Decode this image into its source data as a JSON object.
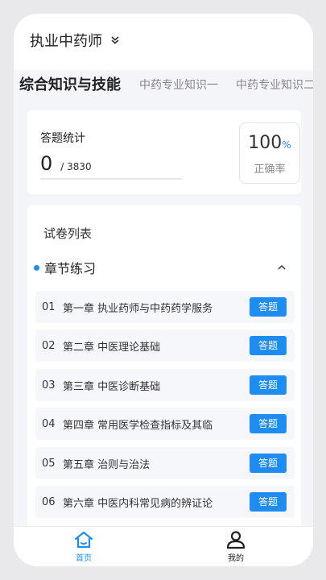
{
  "header": {
    "title": "执业中药师"
  },
  "tabs": [
    {
      "label": "综合知识与技能",
      "active": true
    },
    {
      "label": "中药专业知识一",
      "active": false
    },
    {
      "label": "中药专业知识二",
      "active": false
    }
  ],
  "stats": {
    "label": "答题统计",
    "answered": "0",
    "total": "/ 3830",
    "progress_fraction": 0,
    "accuracy_value": "100",
    "accuracy_symbol": "%",
    "accuracy_label": "正确率"
  },
  "paper_list": {
    "title": "试卷列表",
    "section": {
      "name": "章节练习",
      "expanded": true
    },
    "chapters": [
      {
        "index": "01",
        "label": "第一章 执业药师与中药药学服务",
        "action": "答题"
      },
      {
        "index": "02",
        "label": "第二章 中医理论基础",
        "action": "答题"
      },
      {
        "index": "03",
        "label": "第三章 中医诊断基础",
        "action": "答题"
      },
      {
        "index": "04",
        "label": "第四章 常用医学检查指标及其临",
        "action": "答题"
      },
      {
        "index": "05",
        "label": "第五章 治则与治法",
        "action": "答题"
      },
      {
        "index": "06",
        "label": "第六章 中医内科常见病的辨证论",
        "action": "答题"
      }
    ]
  },
  "bottom_nav": {
    "home": {
      "label": "首页",
      "icon": "home-icon"
    },
    "mine": {
      "label": "我的",
      "icon": "user-icon"
    }
  },
  "colors": {
    "accent": "#1e8cf0",
    "background": "#f4f5f9"
  }
}
